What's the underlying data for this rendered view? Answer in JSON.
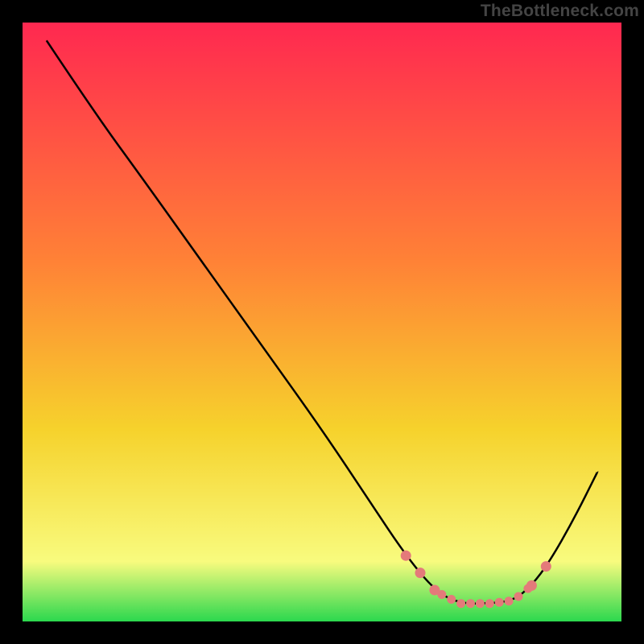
{
  "watermark": "TheBottleneck.com",
  "chart_data": {
    "type": "line",
    "title": "",
    "xlabel": "",
    "ylabel": "",
    "xlim": [
      0,
      100
    ],
    "ylim": [
      0,
      100
    ],
    "curve": [
      {
        "x": 4,
        "y": 97
      },
      {
        "x": 12,
        "y": 85
      },
      {
        "x": 20,
        "y": 74
      },
      {
        "x": 30,
        "y": 60
      },
      {
        "x": 40,
        "y": 46
      },
      {
        "x": 50,
        "y": 32
      },
      {
        "x": 58,
        "y": 20
      },
      {
        "x": 64,
        "y": 11
      },
      {
        "x": 69,
        "y": 5
      },
      {
        "x": 73,
        "y": 3
      },
      {
        "x": 78,
        "y": 3
      },
      {
        "x": 82,
        "y": 3.5
      },
      {
        "x": 85,
        "y": 6
      },
      {
        "x": 88,
        "y": 10
      },
      {
        "x": 92,
        "y": 17
      },
      {
        "x": 96,
        "y": 25
      }
    ],
    "dotted_segments": [
      {
        "start": 64,
        "end": 70
      },
      {
        "start": 70,
        "end": 85
      },
      {
        "start": 85,
        "end": 88
      }
    ],
    "gradient": {
      "top": "#ff2850",
      "mid1": "#ff8236",
      "mid2": "#f6d22c",
      "mid3": "#f8fb7e",
      "bottom": "#2bd84e"
    },
    "dot_color": "#e47a7a",
    "line_color": "#000000"
  }
}
